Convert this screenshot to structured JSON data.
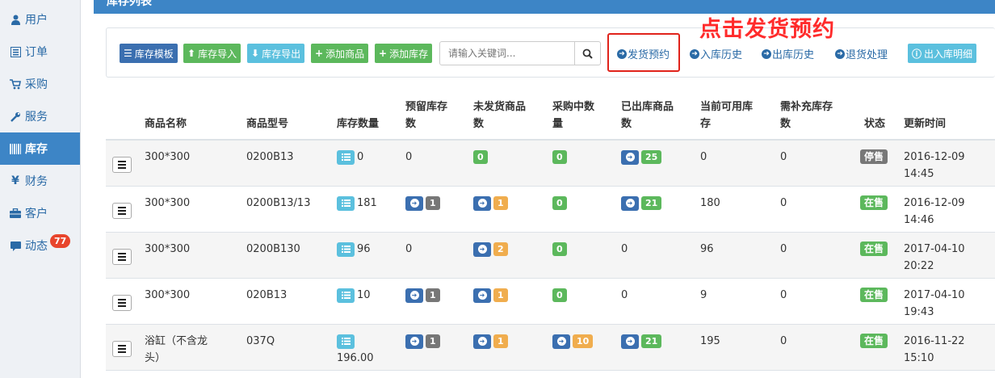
{
  "sidebar": {
    "items": [
      {
        "label": "用户",
        "icon": "user-icon"
      },
      {
        "label": "订单",
        "icon": "list-icon"
      },
      {
        "label": "采购",
        "icon": "cart-icon"
      },
      {
        "label": "服务",
        "icon": "wrench-icon"
      },
      {
        "label": "库存",
        "icon": "barcode-icon",
        "active": true
      },
      {
        "label": "财务",
        "icon": "yen-icon"
      },
      {
        "label": "客户",
        "icon": "briefcase-icon"
      },
      {
        "label": "动态",
        "icon": "comment-icon",
        "badge": "77"
      }
    ]
  },
  "header": {
    "title": "库存列表"
  },
  "toolbar": {
    "buttons": [
      "库存模板",
      "库存导入",
      "库存导出",
      "添加商品",
      "添加库存"
    ],
    "search_placeholder": "请输入关键词...",
    "links": [
      "发货预约",
      "入库历史",
      "出库历史",
      "退货处理"
    ],
    "detail_button": "出入库明细"
  },
  "annotation": "点击发货预约",
  "table": {
    "headers": {
      "name": "商品名称",
      "model": "商品型号",
      "stock": "库存数量",
      "reserved_1": "预留库存",
      "reserved_2": "数",
      "unshipped_1": "未发货商品",
      "unshipped_2": "数",
      "purchasing_1": "采购中数",
      "purchasing_2": "量",
      "shipped_1": "已出库商品",
      "shipped_2": "数",
      "available_1": "当前可用库",
      "available_2": "存",
      "replenish_1": "需补充库存",
      "replenish_2": "数",
      "status": "状态",
      "updated": "更新时间"
    },
    "rows": [
      {
        "name": "300*300",
        "model": "0200B13",
        "stock": "0",
        "reserved": "0",
        "unshipped": "0",
        "purchasing": "0",
        "shipped": "25",
        "available": "0",
        "replenish": "0",
        "status": "停售",
        "date": "2016-12-09",
        "time": "14:45"
      },
      {
        "name": "300*300",
        "model": "0200B13/13",
        "stock": "181",
        "reserved": "1",
        "unshipped": "1",
        "purchasing": "0",
        "shipped": "21",
        "available": "180",
        "replenish": "0",
        "status": "在售",
        "date": "2016-12-09",
        "time": "14:46"
      },
      {
        "name": "300*300",
        "model": "0200B130",
        "stock": "96",
        "reserved": "0",
        "unshipped": "2",
        "purchasing": "0",
        "shipped": "0",
        "available": "96",
        "replenish": "0",
        "status": "在售",
        "date": "2017-04-10",
        "time": "20:22"
      },
      {
        "name": "300*300",
        "model": "020B13",
        "stock": "10",
        "reserved": "1",
        "unshipped": "1",
        "purchasing": "0",
        "shipped": "0",
        "available": "9",
        "replenish": "0",
        "status": "在售",
        "date": "2017-04-10",
        "time": "19:43"
      },
      {
        "name_1": "浴缸（不含龙",
        "name_2": "头）",
        "model": "037Q",
        "stock": "196.00",
        "reserved": "1",
        "unshipped": "1",
        "purchasing": "10",
        "shipped": "21",
        "available": "195",
        "replenish": "0",
        "status": "在售",
        "date": "2016-11-22",
        "time": "15:10"
      }
    ]
  }
}
